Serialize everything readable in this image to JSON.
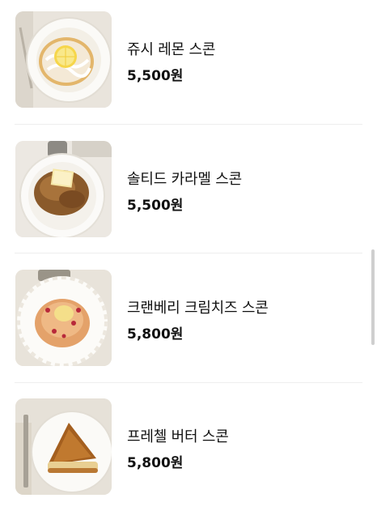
{
  "menu": {
    "items": [
      {
        "name": "쥬시 레몬 스콘",
        "price": "5,500원",
        "image": "lemon-scone-photo"
      },
      {
        "name": "솔티드 카라멜 스콘",
        "price": "5,500원",
        "image": "caramel-scone-photo"
      },
      {
        "name": "크랜베리 크림치즈 스콘",
        "price": "5,800원",
        "image": "cranberry-scone-photo"
      },
      {
        "name": "프레첼 버터 스콘",
        "price": "5,800원",
        "image": "pretzel-scone-photo"
      }
    ]
  }
}
